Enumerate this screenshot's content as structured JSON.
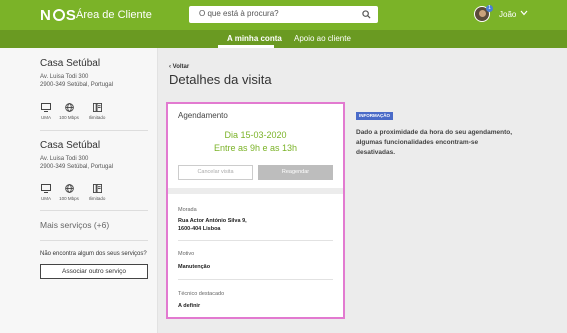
{
  "header": {
    "logo_text": "NOS",
    "app_title": "Área de Cliente",
    "search_placeholder": "O que está à procura?",
    "user_name": "João",
    "notification_count": "1",
    "brand_color": "#7bb328"
  },
  "subnav": {
    "tabs": [
      {
        "label": "A minha conta",
        "active": true
      },
      {
        "label": "Apoio ao cliente",
        "active": false
      }
    ]
  },
  "sidebar": {
    "homes": [
      {
        "name": "Casa Setúbal",
        "address_line1": "Av. Luisa Todi 300",
        "address_line2": "2900-349 Setúbal, Portugal",
        "services": [
          {
            "icon": "tv-icon",
            "label": "UMA"
          },
          {
            "icon": "globe-icon",
            "label": "100 Mbps"
          },
          {
            "icon": "phone-icon",
            "label": "Ilimitado"
          }
        ]
      },
      {
        "name": "Casa Setúbal",
        "address_line1": "Av. Luisa Todi 300",
        "address_line2": "2900-349 Setúbal, Portugal",
        "services": [
          {
            "icon": "tv-icon",
            "label": "UMA"
          },
          {
            "icon": "globe-icon",
            "label": "100 Mbps"
          },
          {
            "icon": "phone-icon",
            "label": "Ilimitado"
          }
        ]
      }
    ],
    "more_services": "Mais serviços (+6)",
    "not_found_text": "Não encontra algum dos seus serviços?",
    "associate_button": "Associar outro serviço"
  },
  "main": {
    "back_label": "Voltar",
    "page_title": "Detalhes da visita",
    "appointment": {
      "title": "Agendamento",
      "date": "Dia 15-03-2020",
      "time": "Entre as 9h e as 13h",
      "cancel_label": "Cancelar visita",
      "reschedule_label": "Reagendar"
    },
    "fields": [
      {
        "label": "Morada",
        "value_line1": "Rua Actor António Silva 9,",
        "value_line2": "1600-404 Lisboa"
      },
      {
        "label": "Motivo",
        "value_line1": "Manutenção",
        "value_line2": ""
      },
      {
        "label": "Técnico destacado",
        "value_line1": "A definir",
        "value_line2": ""
      }
    ],
    "info": {
      "tag": "INFORMAÇÃO",
      "text": "Dado a proximidade da hora do seu agendamento, algumas funcionalidades encontram-se desativadas."
    }
  }
}
